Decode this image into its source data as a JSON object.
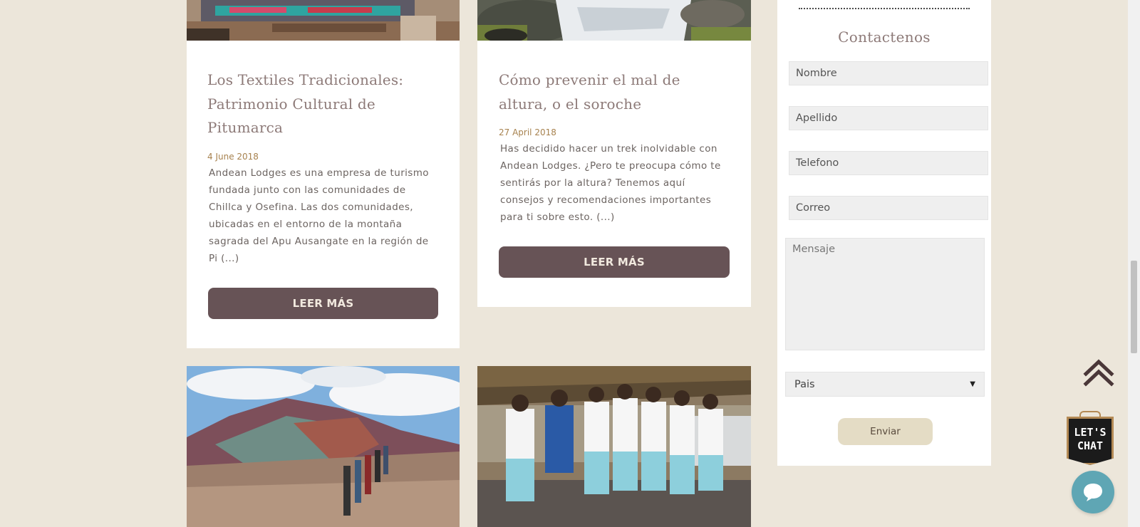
{
  "posts": [
    {
      "title": "Los Textiles Tradicionales: Patrimonio Cultural de Pitumarca",
      "date": "4 June 2018",
      "excerpt": "Andean Lodges es una empresa de turismo fundada junto con las comunidades de Chillca y Osefina. Las dos comunidades, ubicadas en el entorno de la montaña sagrada del Apu Ausangate en la región de Pi (...)",
      "button": "LEER MÁS"
    },
    {
      "title": "Cómo prevenir el mal de altura, o el soroche",
      "date": "27 April 2018",
      "excerpt": "Has decidido hacer un trek inolvidable con Andean Lodges. ¿Pero te preocupa cómo te sentirás por la altura? Tenemos aquí consejos y recomendaciones importantes para ti sobre esto. (...)",
      "button": "LEER MÁS"
    }
  ],
  "contact": {
    "title": "Contactenos",
    "fields": {
      "nombre": "Nombre",
      "apellido": "Apellido",
      "telefono": "Telefono",
      "correo": "Correo",
      "mensaje": "Mensaje"
    },
    "country": "Pais",
    "submit": "Enviar"
  },
  "widgets": {
    "chat_sign_line1": "LET'S",
    "chat_sign_line2": "CHAT"
  },
  "colors": {
    "page_bg": "#ece6da",
    "button_bg": "#675356",
    "title": "#8d7a78",
    "date": "#a7824f",
    "send_button": "#e4dcc5",
    "chat_bubble": "#5fa6b4"
  },
  "icons": [
    "scroll-to-top-icon",
    "lets-chat-sign-icon",
    "chat-bubble-icon"
  ]
}
